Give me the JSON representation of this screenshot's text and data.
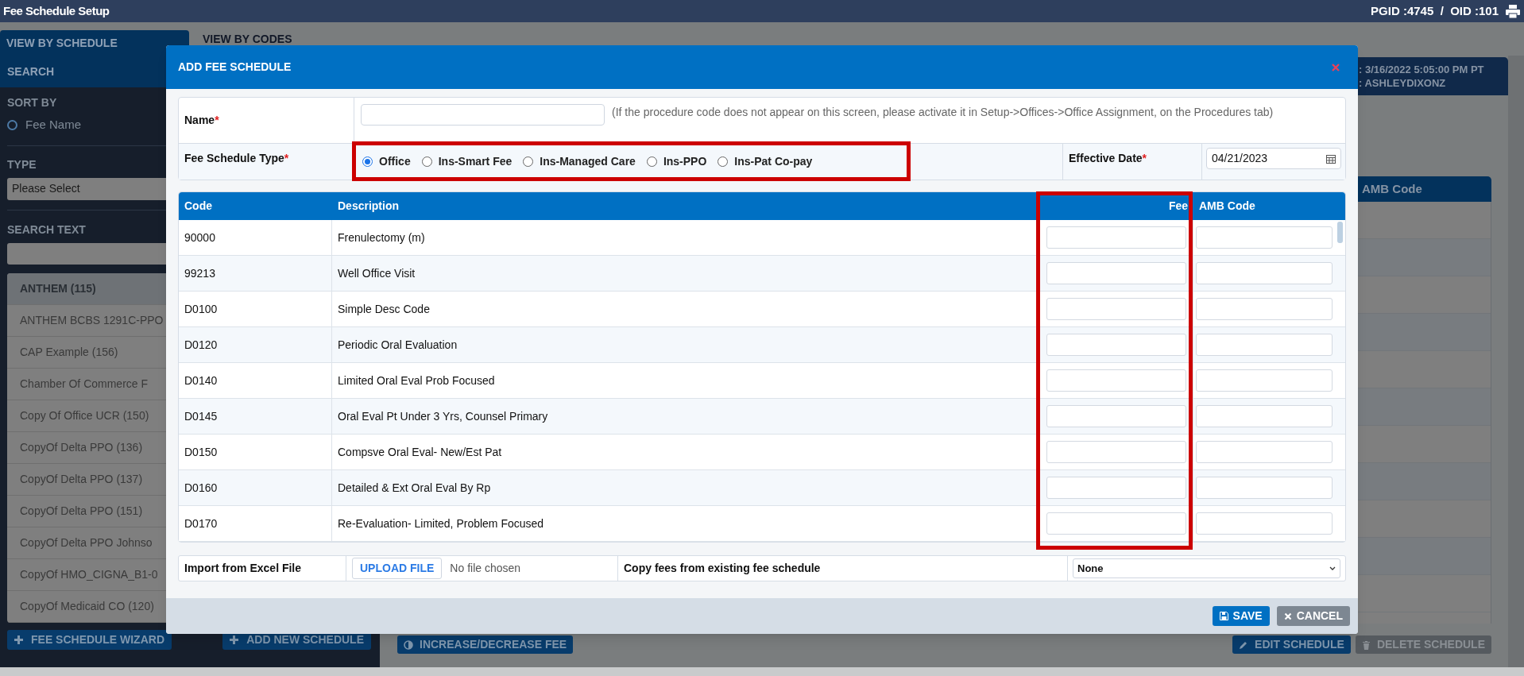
{
  "app_bar": {
    "title": "Fee Schedule Setup",
    "ids": "PGID :4745  /  OID :101"
  },
  "view_tabs": [
    {
      "label": "VIEW BY SCHEDULE",
      "selected": true
    },
    {
      "label": "VIEW BY CODES",
      "selected": false
    }
  ],
  "sidebar": {
    "search_heading": "SEARCH",
    "sort_by": {
      "label": "SORT BY",
      "options": [
        {
          "label": "Fee Name",
          "selected": false
        }
      ]
    },
    "type": {
      "label": "TYPE",
      "value": "Please Select"
    },
    "search_text": {
      "label": "SEARCH TEXT"
    },
    "schedules": [
      {
        "label": "ANTHEM (115)",
        "selected": true
      },
      {
        "label": "ANTHEM BCBS 1291C-PPO",
        "selected": false
      },
      {
        "label": "CAP Example (156)",
        "selected": false
      },
      {
        "label": "Chamber Of Commerce F",
        "selected": false
      },
      {
        "label": "Copy Of Office UCR (150)",
        "selected": false
      },
      {
        "label": "CopyOf Delta PPO (136)",
        "selected": false
      },
      {
        "label": "CopyOf Delta PPO (137)",
        "selected": false
      },
      {
        "label": "CopyOf Delta PPO (151)",
        "selected": false
      },
      {
        "label": "CopyOf Delta PPO Johnso",
        "selected": false
      },
      {
        "label": "CopyOf HMO_CIGNA_B1-0",
        "selected": false
      },
      {
        "label": "CopyOf Medicaid CO (120)",
        "selected": false
      }
    ],
    "buttons": [
      "FEE SCHEDULE WIZARD",
      "ADD NEW SCHEDULE"
    ]
  },
  "background_panel": {
    "info": [
      ": 3/16/2022 5:05:00 PM PT",
      ": ASHLEYDIXONZ"
    ],
    "column": "AMB Code"
  },
  "main_buttons": [
    {
      "label": "INCREASE/DECREASE FEE",
      "kind": "primary"
    },
    {
      "label": "EDIT SCHEDULE",
      "kind": "primary"
    },
    {
      "label": "DELETE SCHEDULE",
      "kind": "secondary"
    }
  ],
  "dialog": {
    "title": "ADD FEE SCHEDULE",
    "name": {
      "label": "Name",
      "required_mark": "*",
      "hint": "(If the procedure code does not appear on this screen, please activate it in Setup->Offices->Office Assignment, on the Procedures tab)"
    },
    "fee_schedule_type": {
      "label": "Fee Schedule Type",
      "required_mark": "*",
      "highlighted": true,
      "options": [
        {
          "label": "Office",
          "selected": true
        },
        {
          "label": "Ins-Smart Fee",
          "selected": false
        },
        {
          "label": "Ins-Managed Care",
          "selected": false
        },
        {
          "label": "Ins-PPO",
          "selected": false
        },
        {
          "label": "Ins-Pat Co-pay",
          "selected": false
        }
      ]
    },
    "effective_date": {
      "label": "Effective Date",
      "required_mark": "*",
      "value": "04/21/2023"
    },
    "table": {
      "columns": [
        {
          "label": "Code"
        },
        {
          "label": "Description"
        },
        {
          "label": "Fee",
          "highlighted": true
        },
        {
          "label": "AMB Code"
        }
      ],
      "rows": [
        {
          "code": "90000",
          "description": "Frenulectomy (m)"
        },
        {
          "code": "99213",
          "description": "Well Office Visit"
        },
        {
          "code": "D0100",
          "description": "Simple Desc Code"
        },
        {
          "code": "D0120",
          "description": "Periodic Oral Evaluation"
        },
        {
          "code": "D0140",
          "description": "Limited Oral Eval Prob Focused"
        },
        {
          "code": "D0145",
          "description": "Oral Eval Pt Under 3 Yrs, Counsel Primary"
        },
        {
          "code": "D0150",
          "description": "Compsve Oral Eval- New/Est Pat"
        },
        {
          "code": "D0160",
          "description": "Detailed & Ext Oral Eval By Rp"
        },
        {
          "code": "D0170",
          "description": "Re-Evaluation- Limited, Problem Focused"
        }
      ]
    },
    "import": {
      "label": "Import from Excel File",
      "button": "UPLOAD FILE",
      "status": "No file chosen"
    },
    "copy_fees": {
      "label": "Copy fees from existing fee schedule",
      "value": "None"
    },
    "buttons": [
      {
        "label": "SAVE",
        "kind": "primary"
      },
      {
        "label": "CANCEL",
        "kind": "secondary"
      }
    ]
  }
}
